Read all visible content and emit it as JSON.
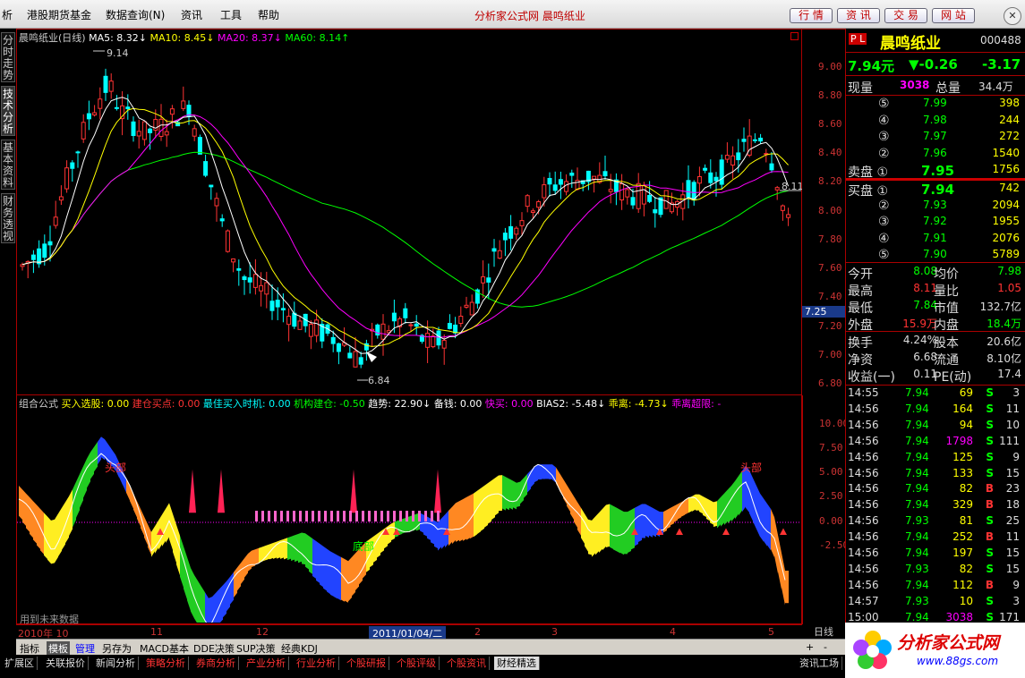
{
  "menu": {
    "items": [
      "析",
      "港股期货基金",
      "数据查询(N)",
      "资讯",
      "工具",
      "帮助"
    ],
    "title": "分析家公式网  晨鸣纸业",
    "buttons": [
      "行 情",
      "资 讯",
      "交 易",
      "网 站"
    ],
    "close": "✕"
  },
  "left_tabs": [
    "分时走势",
    "技术分析",
    "基本资料",
    "财务透视"
  ],
  "main": {
    "title": "晨鸣纸业(日线)",
    "ma5": "MA5: 8.32↓",
    "ma10": "MA10: 8.45↓",
    "ma20": "MA20: 8.37↓",
    "ma60": "MA60: 8.14↑",
    "hi_label": "9.14",
    "lo_label": "6.84",
    "last_label": "8.11",
    "price_ticks": [
      "9.00",
      "8.80",
      "8.60",
      "8.40",
      "8.20",
      "8.00",
      "7.80",
      "7.60",
      "7.40",
      "7.20",
      "7.00",
      "6.80"
    ],
    "cursor_price": "7.25",
    "colors": {
      "ma5": "#ffffff",
      "ma10": "#ffff00",
      "ma20": "#ff00ff",
      "ma60": "#00ff00",
      "up": "#ff3333",
      "down": "#00ffff"
    }
  },
  "sub": {
    "indicator": "组合公式",
    "items": [
      {
        "label": "买入选股: 0.00",
        "color": "#ffff00"
      },
      {
        "label": "建仓买点: 0.00",
        "color": "#ff3333"
      },
      {
        "label": "最佳买入时机: 0.00",
        "color": "#00ffff"
      },
      {
        "label": "机构建仓: -0.50",
        "color": "#00ff00"
      },
      {
        "label": "趋势: 22.90↓",
        "color": "#ffffff"
      },
      {
        "label": "备钱: 0.00",
        "color": "#ffffff"
      },
      {
        "label": "快买: 0.00",
        "color": "#ff00ff"
      },
      {
        "label": "BIAS2: -5.48↓",
        "color": "#ffffff"
      },
      {
        "label": "乖离: -4.73↓",
        "color": "#ffff00"
      },
      {
        "label": "乖离超限: -",
        "color": "#ff00ff"
      }
    ],
    "ticks": [
      "10.00",
      "7.50",
      "5.00",
      "2.50",
      "0.00",
      "-2.50"
    ],
    "top_label1": "头部",
    "top_label2": "头部",
    "bottom_label": "底部",
    "note": "用到未来数据"
  },
  "dates": [
    "2010年 10",
    "11",
    "12",
    "2011/01/04/二",
    "2",
    "3",
    "4",
    "5"
  ],
  "period": "日线",
  "tabbar1": [
    "指标",
    "模板",
    "管理",
    "另存为",
    "MACD基本",
    "DDE决策",
    "SUP决策",
    "经典KDJ"
  ],
  "tabbar1_right": [
    "+",
    "-"
  ],
  "tabbar2": [
    "扩展区",
    "关联报价",
    "新闻分析",
    "策略分析",
    "券商分析",
    "产业分析",
    "行业分析",
    "个股研报",
    "个股评级",
    "个股资讯",
    "财经精选"
  ],
  "tabbar2_right": "资讯工场",
  "quote": {
    "badge": "P L",
    "name": "晨鸣纸业",
    "code": "000488",
    "price": "7.94元",
    "change": "▼-0.26",
    "pct": "-3.17",
    "now_vol_label": "现量",
    "now_vol": "3038",
    "total_vol_label": "总量",
    "total_vol": "34.4万",
    "asks": [
      {
        "lvl": "⑤",
        "p": "7.99",
        "v": "398"
      },
      {
        "lvl": "④",
        "p": "7.98",
        "v": "244"
      },
      {
        "lvl": "③",
        "p": "7.97",
        "v": "272"
      },
      {
        "lvl": "②",
        "p": "7.96",
        "v": "1540"
      },
      {
        "lvl": "卖盘 ①",
        "p": "7.95",
        "v": "1756"
      }
    ],
    "bids": [
      {
        "lvl": "买盘 ①",
        "p": "7.94",
        "v": "742"
      },
      {
        "lvl": "②",
        "p": "7.93",
        "v": "2094"
      },
      {
        "lvl": "③",
        "p": "7.92",
        "v": "1955"
      },
      {
        "lvl": "④",
        "p": "7.91",
        "v": "2076"
      },
      {
        "lvl": "⑤",
        "p": "7.90",
        "v": "5789"
      }
    ],
    "stats": [
      {
        "l1": "今开",
        "v1": "8.08",
        "l2": "均价",
        "v2": "7.98"
      },
      {
        "l1": "最高",
        "v1": "8.11",
        "l2": "量比",
        "v2": "1.05"
      },
      {
        "l1": "最低",
        "v1": "7.84",
        "l2": "市值",
        "v2": "132.7亿"
      },
      {
        "l1": "外盘",
        "v1": "15.9万",
        "l2": "内盘",
        "v2": "18.4万"
      }
    ],
    "fin": [
      {
        "l1": "换手",
        "v1": "4.24%",
        "l2": "股本",
        "v2": "20.6亿"
      },
      {
        "l1": "净资",
        "v1": "6.68",
        "l2": "流通",
        "v2": "8.10亿"
      },
      {
        "l1": "收益(一)",
        "v1": "0.11",
        "l2": "PE(动)",
        "v2": "17.4"
      }
    ],
    "ticks": [
      [
        "14:55",
        "7.94",
        "69",
        "S",
        "3"
      ],
      [
        "14:56",
        "7.94",
        "164",
        "S",
        "11"
      ],
      [
        "14:56",
        "7.94",
        "94",
        "S",
        "10"
      ],
      [
        "14:56",
        "7.94",
        "1798",
        "S",
        "111"
      ],
      [
        "14:56",
        "7.94",
        "125",
        "S",
        "9"
      ],
      [
        "14:56",
        "7.94",
        "133",
        "S",
        "15"
      ],
      [
        "14:56",
        "7.94",
        "82",
        "B",
        "23"
      ],
      [
        "14:56",
        "7.94",
        "329",
        "B",
        "18"
      ],
      [
        "14:56",
        "7.93",
        "81",
        "S",
        "25"
      ],
      [
        "14:56",
        "7.94",
        "252",
        "B",
        "11"
      ],
      [
        "14:56",
        "7.94",
        "197",
        "S",
        "15"
      ],
      [
        "14:56",
        "7.93",
        "82",
        "S",
        "15"
      ],
      [
        "14:56",
        "7.94",
        "112",
        "B",
        "9"
      ],
      [
        "14:57",
        "7.93",
        "10",
        "S",
        "3"
      ],
      [
        "15:00",
        "7.94",
        "3038",
        "S",
        "171"
      ]
    ]
  },
  "logo": {
    "text": "分析家公式网",
    "site": "www.88gs.com"
  }
}
